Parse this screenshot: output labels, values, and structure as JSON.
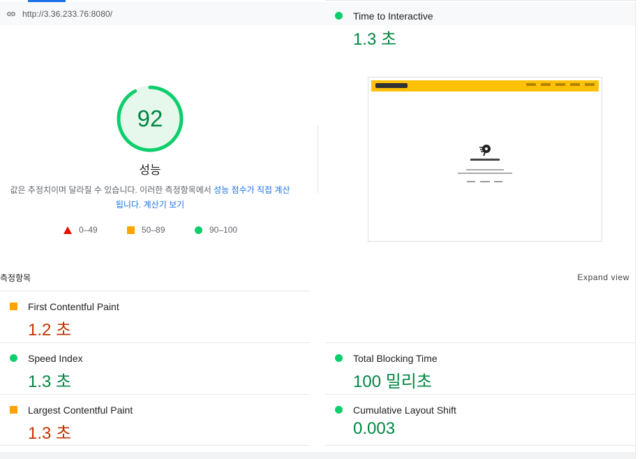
{
  "url": "http://3.36.233.76:8080/",
  "performance": {
    "score": "92",
    "score_fraction": 0.92,
    "label": "성능",
    "description_prefix": "값은 추정치이며 달라질 수 있습니다. 이러한 측정항목에서 ",
    "description_link": "성능 점수가 직접 계산됩니다.",
    "calculator_link": "계산기 보기"
  },
  "legend": [
    {
      "range": "0–49",
      "shape": "triangle",
      "color": "#eb0f00"
    },
    {
      "range": "50–89",
      "shape": "square",
      "color": "#ffa400"
    },
    {
      "range": "90–100",
      "shape": "circle",
      "color": "#0cce6b"
    }
  ],
  "metrics_section": {
    "title": "측정항목",
    "expand_label": "Expand view"
  },
  "metrics": [
    {
      "name": "First Contentful Paint",
      "value": "1.2 초",
      "status": "average"
    },
    {
      "name": "Time to Interactive",
      "value": "1.3 초",
      "status": "pass"
    },
    {
      "name": "Speed Index",
      "value": "1.3 초",
      "status": "pass"
    },
    {
      "name": "Total Blocking Time",
      "value": "100 밀리초",
      "status": "pass"
    },
    {
      "name": "Largest Contentful Paint",
      "value": "1.3 초",
      "status": "average"
    },
    {
      "name": "Cumulative Layout Shift",
      "value": "0.003",
      "status": "pass"
    }
  ],
  "colors": {
    "accent": "#1a73e8",
    "pass": "#0cce6b",
    "pass_text": "#018642",
    "average": "#ffa400",
    "average_text": "#c33300",
    "fail": "#eb0f00"
  }
}
